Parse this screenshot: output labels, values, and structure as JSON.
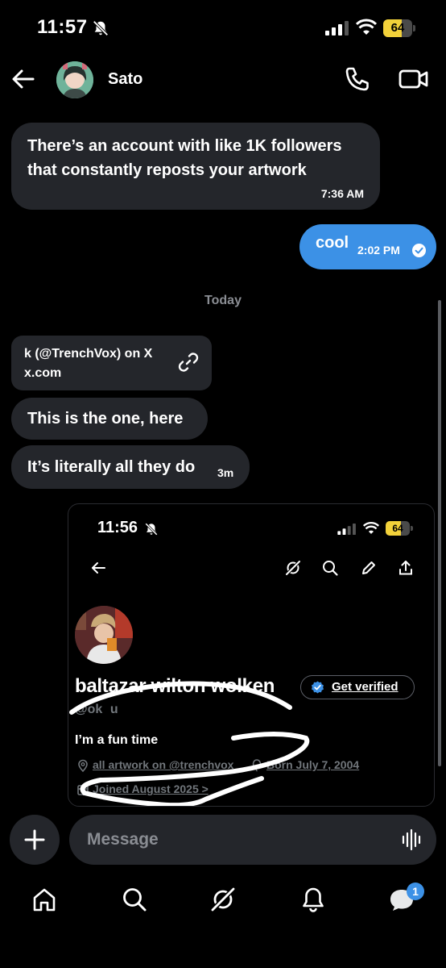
{
  "status_bar": {
    "time": "11:57",
    "battery": "64",
    "battery_level": 0.64,
    "accent": "#f2d13a"
  },
  "header": {
    "contact_name": "Sato"
  },
  "conversation": {
    "messages": [
      {
        "text": "There’s an account with like 1K followers that constantly reposts your artwork",
        "time": "7:36 AM",
        "direction": "incoming"
      },
      {
        "text": "cool",
        "time": "2:02 PM",
        "direction": "outgoing",
        "status": "read"
      }
    ],
    "day_separator": "Today",
    "link_preview": {
      "title": "k (@TrenchVox) on X",
      "domain": "x.com"
    },
    "messages_today": [
      {
        "text": "This is the one, here"
      },
      {
        "text": "It’s literally all they do",
        "time": "3m"
      }
    ],
    "outgoing_bubble_color": "#3c91e6",
    "incoming_bubble_color": "#24262b"
  },
  "shared_screenshot": {
    "status_time": "11:56",
    "battery": "64",
    "battery_level": 0.64,
    "profile_name": "baltazar wilton wolken",
    "get_verified": "Get verified",
    "handle": "@ok   u",
    "bio": "I’m a fun time",
    "location": "all artwork on @trenchvox",
    "birthday": "Born July 7, 2004",
    "joined": "Joined August 2025 >"
  },
  "composer": {
    "placeholder": "Message"
  },
  "tab_bar": {
    "messages_badge": "1"
  }
}
